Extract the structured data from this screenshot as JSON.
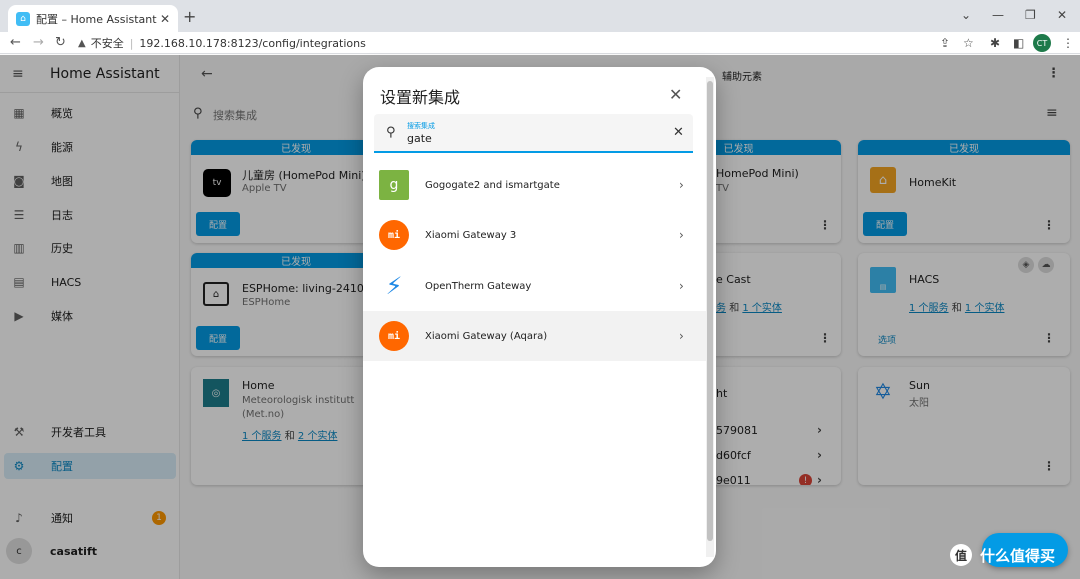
{
  "browser": {
    "tab_title": "配置 – Home Assistant",
    "security_label": "不安全",
    "url": "192.168.10.178:8123/config/integrations",
    "profile_initials": "CT"
  },
  "sidebar": {
    "title": "Home Assistant",
    "items": [
      {
        "label": "概览",
        "icon": "dashboard-icon"
      },
      {
        "label": "能源",
        "icon": "lightning-icon"
      },
      {
        "label": "地图",
        "icon": "map-icon"
      },
      {
        "label": "日志",
        "icon": "list-icon"
      },
      {
        "label": "历史",
        "icon": "chart-icon"
      },
      {
        "label": "HACS",
        "icon": "hacs-icon"
      },
      {
        "label": "媒体",
        "icon": "media-icon"
      }
    ],
    "dev_tools": "开发者工具",
    "config": "配置",
    "notifications": "通知",
    "notification_count": "1",
    "user_initial": "c",
    "user_name": "casatift"
  },
  "main": {
    "toolbar_title_partial": "辅助元素",
    "search_placeholder": "搜索集成",
    "discovered_label": "已发现",
    "configure_label": "配置",
    "options_label": "选项",
    "cards": {
      "homepod": {
        "name": "儿童房 (HomePod Mini)",
        "sub": "Apple TV"
      },
      "esphome": {
        "name": "ESPHome: living-2410",
        "sub": "ESPHome"
      },
      "met": {
        "name": "Home",
        "sub": "Meteorologisk institutt (Met.no)",
        "link_services": "1 个服务",
        "and": "和",
        "link_entities": "2 个实体"
      },
      "homepod2": {
        "name": "HomePod Mini)",
        "sub": "TV"
      },
      "cast": {
        "name": "e Cast",
        "link_services": "务",
        "and": "和",
        "link_entities": "1 个实体"
      },
      "ht": {
        "name": "ht",
        "rows": [
          "579081",
          "d60fcf",
          "9e011"
        ]
      },
      "homekit": {
        "name": "HomeKit"
      },
      "hacs": {
        "name": "HACS",
        "link_services": "1 个服务",
        "and": "和",
        "link_entities": "1 个实体"
      },
      "sun": {
        "name": "Sun",
        "sub": "太阳"
      }
    }
  },
  "dialog": {
    "title": "设置新集成",
    "search_label": "搜索集成",
    "search_value": "gate",
    "results": [
      {
        "name": "Gogogate2 and ismartgate",
        "logo": "gogogate-logo"
      },
      {
        "name": "Xiaomi Gateway 3",
        "logo": "xiaomi-logo"
      },
      {
        "name": "OpenTherm Gateway",
        "logo": "opentherm-logo"
      },
      {
        "name": "Xiaomi Gateway (Aqara)",
        "logo": "xiaomi-logo"
      }
    ]
  },
  "watermark": {
    "text": "什么值得买",
    "logo_char": "值"
  },
  "colors": {
    "accent": "#039be5",
    "xiaomi": "#ff6700",
    "sidebar_active": "#d9eefa"
  }
}
